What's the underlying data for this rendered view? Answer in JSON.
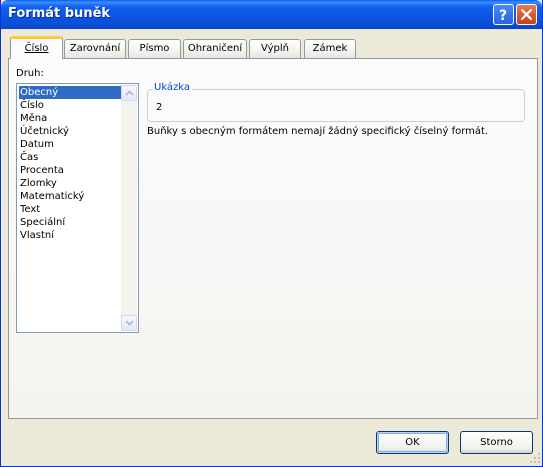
{
  "window": {
    "title": "Formát buněk"
  },
  "titlebar_buttons": {
    "help_icon": "question-mark",
    "close_icon": "x"
  },
  "tabs": [
    {
      "label": "Číslo",
      "active": true
    },
    {
      "label": "Zarovnání",
      "active": false
    },
    {
      "label": "Písmo",
      "active": false
    },
    {
      "label": "Ohraničení",
      "active": false
    },
    {
      "label": "Výplň",
      "active": false
    },
    {
      "label": "Zámek",
      "active": false
    }
  ],
  "category": {
    "label": "Druh:",
    "items": [
      "Obecný",
      "Číslo",
      "Měna",
      "Účetnický",
      "Datum",
      "Čas",
      "Procenta",
      "Zlomky",
      "Matematický",
      "Text",
      "Speciální",
      "Vlastní"
    ],
    "selected": "Obecný"
  },
  "sample": {
    "legend": "Ukázka",
    "value": "2"
  },
  "description": "Buňky s obecným formátem nemají žádný specifický číselný formát.",
  "buttons": {
    "ok": "OK",
    "cancel": "Storno"
  },
  "colors": {
    "title_bar": "#0B55E3",
    "dialog_bg": "#ECE9D8",
    "selection": "#316AC5",
    "active_tab_accent": "#FFC83C",
    "group_legend": "#0046D5"
  }
}
